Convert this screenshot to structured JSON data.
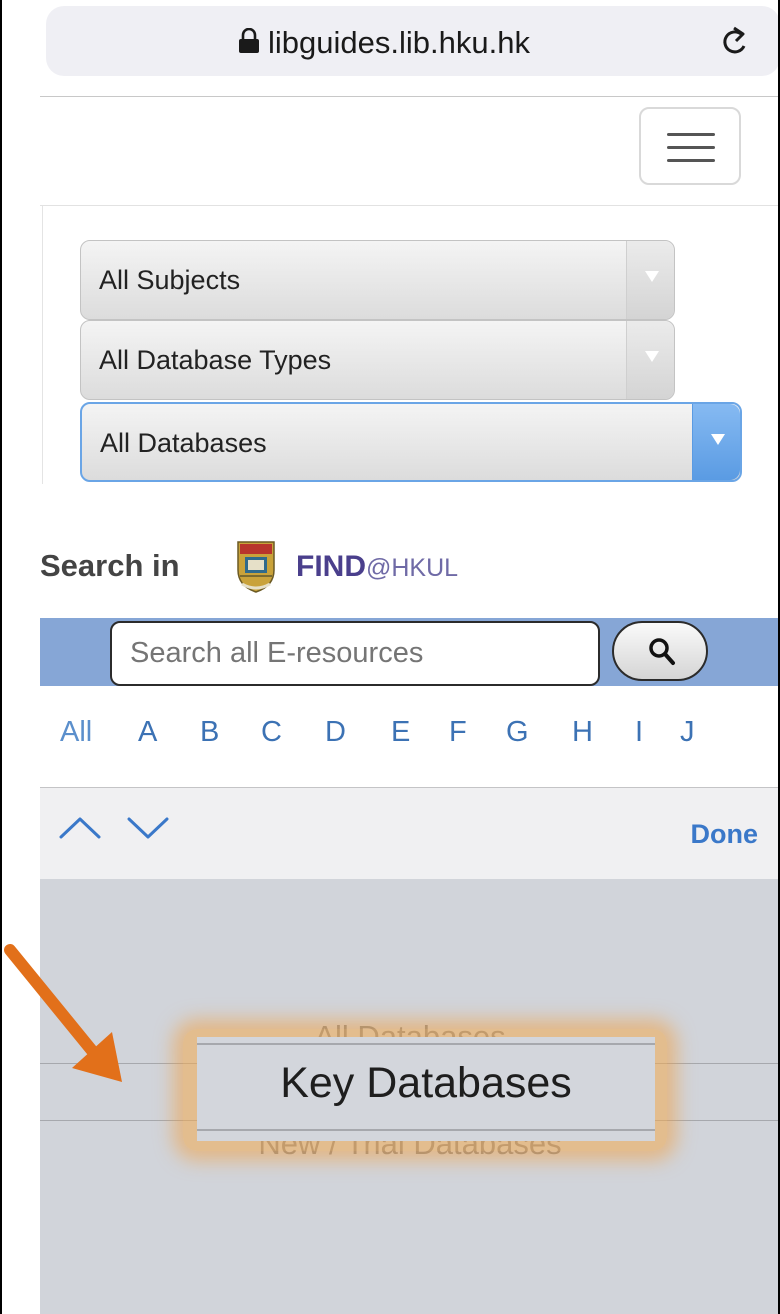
{
  "browser": {
    "url": "libguides.lib.hku.hk"
  },
  "filters": {
    "subjects": "All Subjects",
    "database_types": "All Database Types",
    "databases": "All Databases"
  },
  "search": {
    "label": "Search in",
    "logo_find": "FIND",
    "logo_hkul": "@HKUL",
    "placeholder": "Search all E-resources"
  },
  "alphabet": [
    "All",
    "A",
    "B",
    "C",
    "D",
    "E",
    "F",
    "G",
    "H",
    "I",
    "J"
  ],
  "accessory": {
    "done_label": "Done"
  },
  "picker": {
    "options": [
      "All Databases",
      "Key Databases",
      "New / Trial Databases"
    ],
    "selected": "Key Databases"
  },
  "colors": {
    "accent": "#3a78c9",
    "search_strip": "#86a6d6",
    "highlight": "#f0a046",
    "annotation_arrow": "#e2701a"
  }
}
